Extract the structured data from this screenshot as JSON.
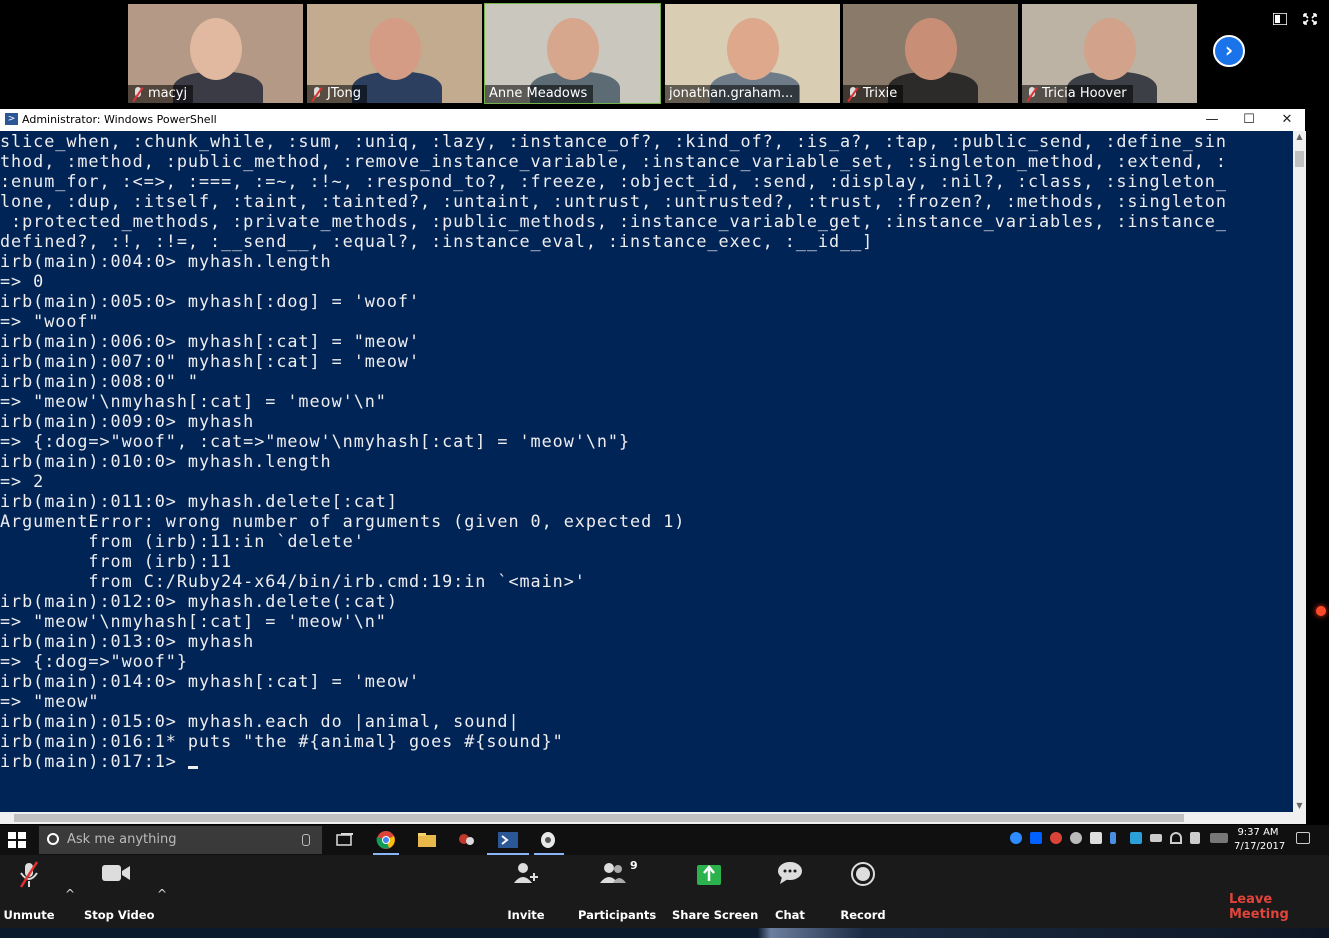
{
  "participants": [
    {
      "name": "macyj",
      "muted": true,
      "active": false,
      "bg": "#b49a86",
      "skin": "#e1b9a0",
      "shirt": "#3b3b46"
    },
    {
      "name": "JTong",
      "muted": true,
      "active": false,
      "bg": "#c2ab8e",
      "skin": "#d49c84",
      "shirt": "#2c3f5e"
    },
    {
      "name": "Anne Meadows",
      "muted": false,
      "active": true,
      "bg": "#c9c7be",
      "skin": "#d7a78d",
      "shirt": "#5c6b74"
    },
    {
      "name": "jonathan.graham...",
      "muted": false,
      "active": false,
      "bg": "#d9cdb4",
      "skin": "#dda88c",
      "shirt": "#6e7c8a"
    },
    {
      "name": "Trixie",
      "muted": true,
      "active": false,
      "bg": "#8a7a6a",
      "skin": "#c98f76",
      "shirt": "#2d2a2a"
    },
    {
      "name": "Tricia Hoover",
      "muted": true,
      "active": false,
      "bg": "#bcb3a4",
      "skin": "#d2a38a",
      "shirt": "#3d3f46"
    }
  ],
  "powershell": {
    "title": "Administrator: Windows PowerShell",
    "lines": [
      "slice_when, :chunk_while, :sum, :uniq, :lazy, :instance_of?, :kind_of?, :is_a?, :tap, :public_send, :define_sin",
      "thod, :method, :public_method, :remove_instance_variable, :instance_variable_set, :singleton_method, :extend, :",
      ":enum_for, :<=>, :===, :=~, :!~, :respond_to?, :freeze, :object_id, :send, :display, :nil?, :class, :singleton_",
      "lone, :dup, :itself, :taint, :tainted?, :untaint, :untrust, :untrusted?, :trust, :frozen?, :methods, :singleton",
      " :protected_methods, :private_methods, :public_methods, :instance_variable_get, :instance_variables, :instance_",
      "defined?, :!, :!=, :__send__, :equal?, :instance_eval, :instance_exec, :__id__]",
      "irb(main):004:0> myhash.length",
      "=> 0",
      "irb(main):005:0> myhash[:dog] = 'woof'",
      "=> \"woof\"",
      "irb(main):006:0> myhash[:cat] = \"meow'",
      "irb(main):007:0\" myhash[:cat] = 'meow'",
      "irb(main):008:0\" \"",
      "=> \"meow'\\nmyhash[:cat] = 'meow'\\n\"",
      "irb(main):009:0> myhash",
      "=> {:dog=>\"woof\", :cat=>\"meow'\\nmyhash[:cat] = 'meow'\\n\"}",
      "irb(main):010:0> myhash.length",
      "=> 2",
      "irb(main):011:0> myhash.delete[:cat]",
      "ArgumentError: wrong number of arguments (given 0, expected 1)",
      "        from (irb):11:in `delete'",
      "        from (irb):11",
      "        from C:/Ruby24-x64/bin/irb.cmd:19:in `<main>'",
      "irb(main):012:0> myhash.delete(:cat)",
      "=> \"meow'\\nmyhash[:cat] = 'meow'\\n\"",
      "irb(main):013:0> myhash",
      "=> {:dog=>\"woof\"}",
      "irb(main):014:0> myhash[:cat] = 'meow'",
      "=> \"meow\"",
      "irb(main):015:0> myhash.each do |animal, sound|",
      "irb(main):016:1* puts \"the #{animal} goes #{sound}\""
    ],
    "prompt": "irb(main):017:1> "
  },
  "taskbar": {
    "search_placeholder": "Ask me anything",
    "time": "9:37 AM",
    "date": "7/17/2017"
  },
  "zoom": {
    "unmute": "Unmute",
    "stop_video": "Stop Video",
    "invite": "Invite",
    "participants": "Participants",
    "participant_count": "9",
    "share_screen": "Share Screen",
    "chat": "Chat",
    "record": "Record",
    "leave": "Leave Meeting"
  }
}
